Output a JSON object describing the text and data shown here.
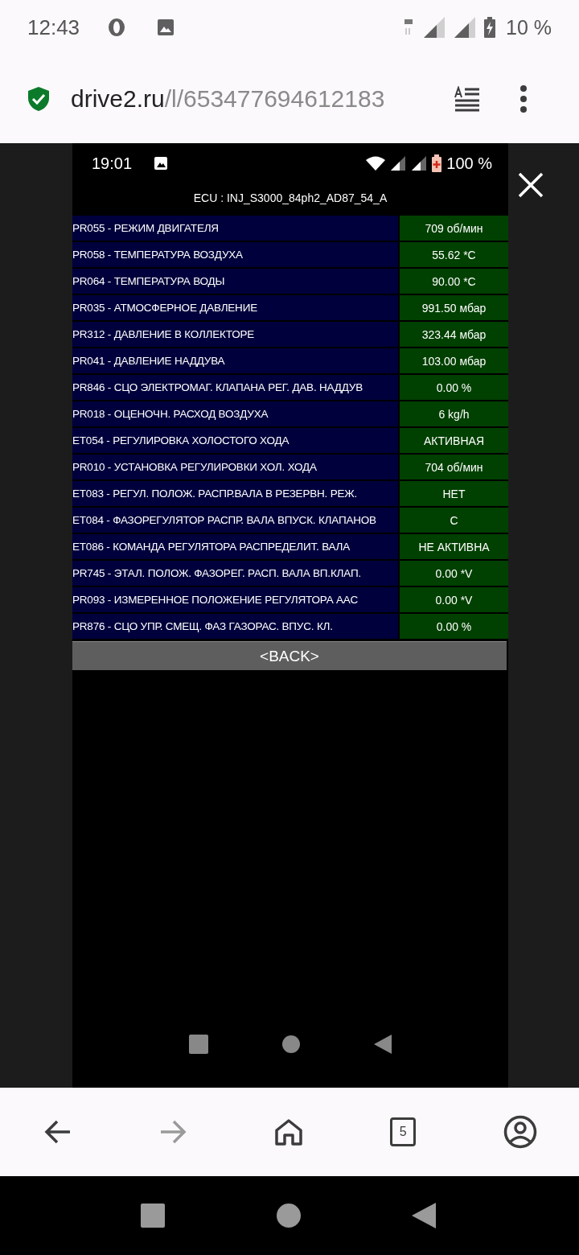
{
  "status_bar": {
    "time": "12:43",
    "battery": "10 %"
  },
  "address_bar": {
    "domain": "drive2.ru",
    "path": "/l/653477694612183"
  },
  "screenshot": {
    "status_bar": {
      "time": "19:01",
      "battery": "100 %"
    },
    "ecu_title": "ECU : INJ_S3000_84ph2_AD87_54_A",
    "rows": [
      {
        "label": "PR055 - РЕЖИМ ДВИГАТЕЛЯ",
        "value": "709 об/мин"
      },
      {
        "label": "PR058 - ТЕМПЕРАТУРА ВОЗДУХА",
        "value": "55.62 *C"
      },
      {
        "label": "PR064 - ТЕМПЕРАТУРА ВОДЫ",
        "value": "90.00 *C"
      },
      {
        "label": "PR035 - АТМОСФЕРНОЕ ДАВЛЕНИЕ",
        "value": "991.50 мбар"
      },
      {
        "label": "PR312 - ДАВЛЕНИЕ В КОЛЛЕКТОРЕ",
        "value": "323.44 мбар"
      },
      {
        "label": "PR041 - ДАВЛЕНИЕ НАДДУВА",
        "value": "103.00 мбар"
      },
      {
        "label": "PR846 - СЦО ЭЛЕКТРОМАГ. КЛАПАНА РЕГ. ДАВ. НАДДУВ",
        "value": "0.00 %"
      },
      {
        "label": "PR018 - ОЦЕНОЧН. РАСХОД ВОЗДУХА",
        "value": "6 kg/h"
      },
      {
        "label": "ET054 - РЕГУЛИРОВКА ХОЛОСТОГО ХОДА",
        "value": "АКТИВНАЯ"
      },
      {
        "label": "PR010 - УСТАНОВКА РЕГУЛИРОВКИ ХОЛ. ХОДА",
        "value": "704 об/мин"
      },
      {
        "label": "ET083 - РЕГУЛ. ПОЛОЖ. РАСПР.ВАЛА В РЕЗЕРВН. РЕЖ.",
        "value": "НЕТ"
      },
      {
        "label": "ET084 - ФАЗОРЕГУЛЯТОР РАСПР. ВАЛА ВПУСК. КЛАПАНОВ",
        "value": "C"
      },
      {
        "label": "ET086 - КОМАНДА РЕГУЛЯТОРА РАСПРЕДЕЛИТ. ВАЛА",
        "value": "НЕ АКТИВНА"
      },
      {
        "label": "PR745 - ЭТАЛ. ПОЛОЖ. ФАЗОРЕГ. РАСП. ВАЛА ВП.КЛАП.",
        "value": "0.00 *V"
      },
      {
        "label": "PR093 - ИЗМЕРЕННОЕ ПОЛОЖЕНИЕ РЕГУЛЯТОРА AAC",
        "value": "0.00 *V"
      },
      {
        "label": "PR876 - СЦО УПР. СМЕЩ. ФАЗ ГАЗОРАС. ВПУС. КЛ.",
        "value": "0.00 %"
      }
    ],
    "back_button": "<BACK>"
  },
  "tabs_count": "5"
}
